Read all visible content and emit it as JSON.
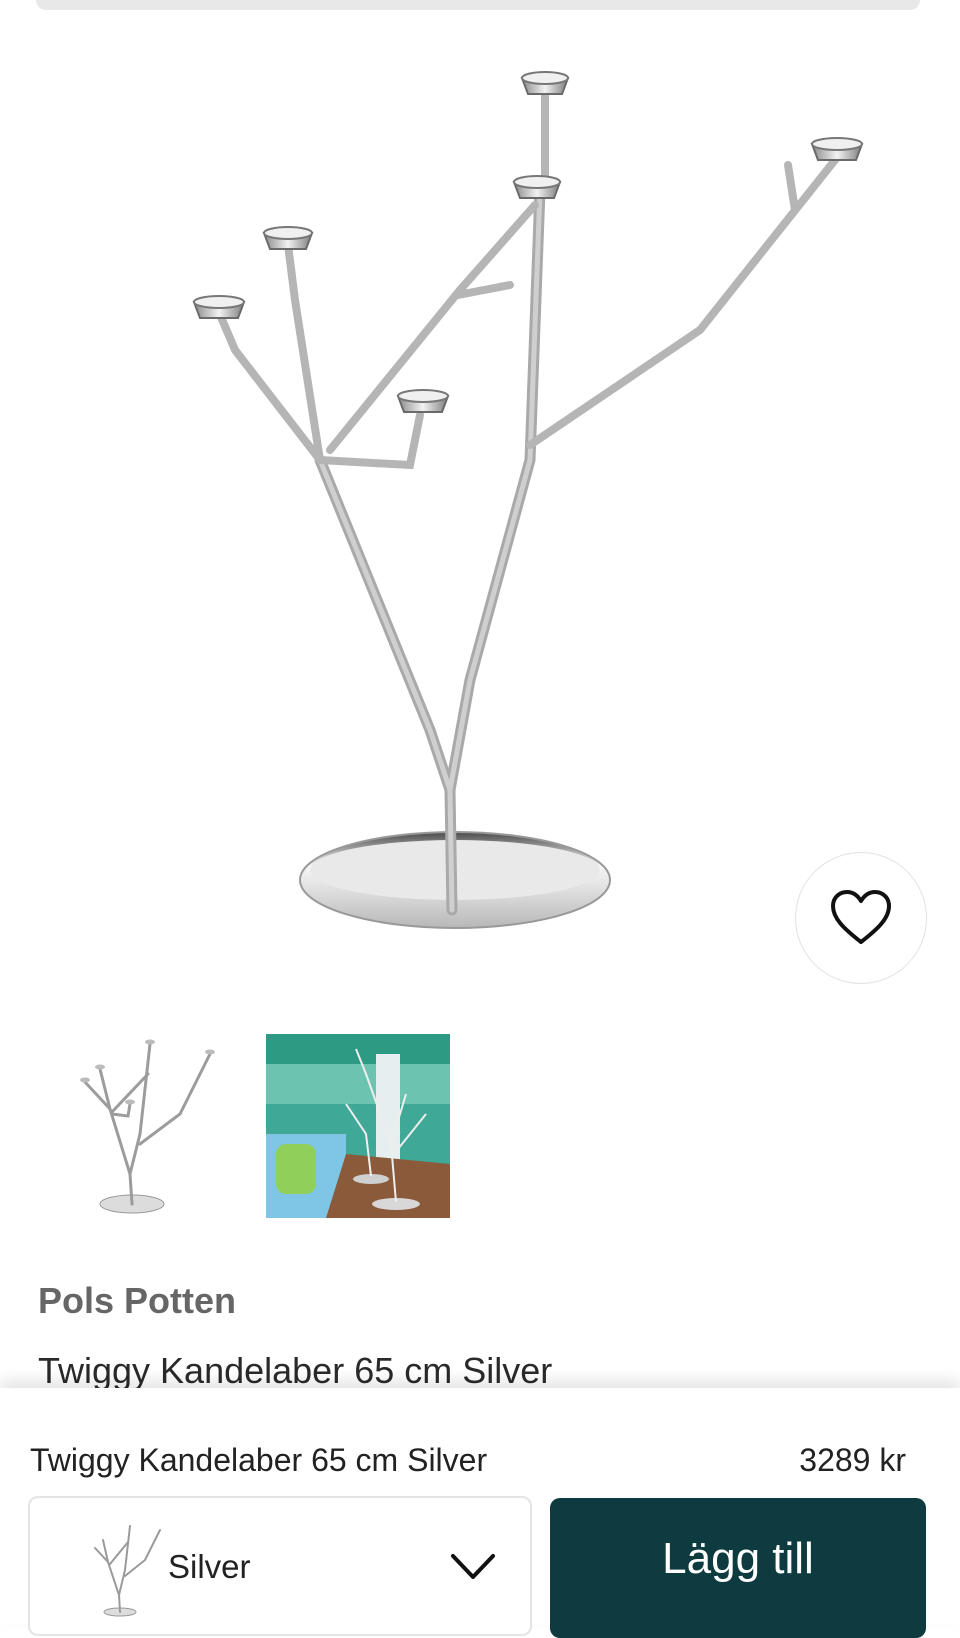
{
  "product": {
    "brand": "Pols Potten",
    "title": "Twiggy Kandelaber 65 cm Silver",
    "price": "3289 kr"
  },
  "gallery": {
    "main_image": "candelabra-product-photo",
    "thumbnails": [
      "candelabra-thumbnail",
      "candelabra-lifestyle-thumbnail"
    ]
  },
  "icons": {
    "favorite": "heart-icon",
    "dropdown": "chevron-down-icon"
  },
  "purchase_bar": {
    "title": "Twiggy Kandelaber 65 cm Silver",
    "price": "3289 kr",
    "variant_selected": "Silver",
    "add_button_label": "Lägg till"
  },
  "colors": {
    "primary_button": "#0d3b3f",
    "brand_text": "#666666"
  }
}
